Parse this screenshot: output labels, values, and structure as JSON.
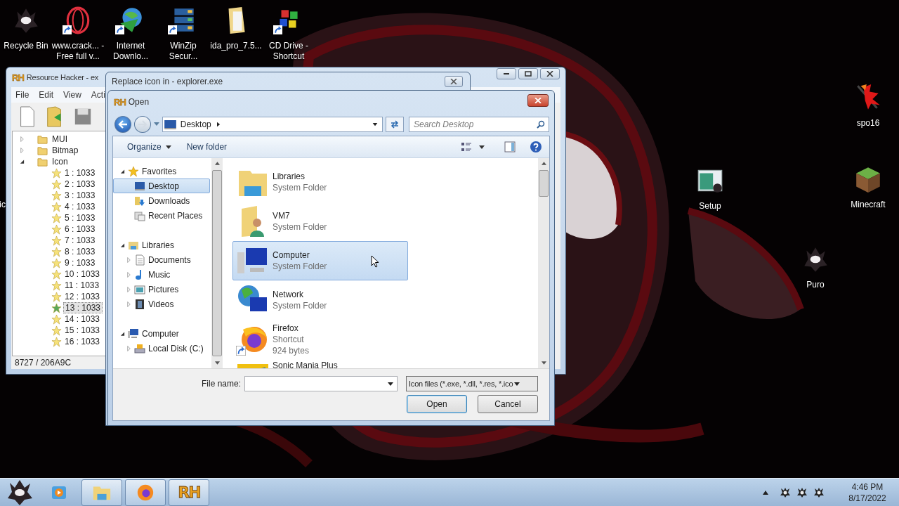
{
  "desktop_icons": [
    {
      "label": "Recycle Bin",
      "kind": "creature",
      "shortcut": false
    },
    {
      "label": "www.crack... - Free full v...",
      "kind": "ring",
      "shortcut": true
    },
    {
      "label": "Internet Downlo...",
      "kind": "globe",
      "shortcut": true
    },
    {
      "label": "WinZip Secur...",
      "kind": "server",
      "shortcut": true
    },
    {
      "label": "ida_pro_7.5...",
      "kind": "folder",
      "shortcut": false
    },
    {
      "label": "CD Drive - Shortcut",
      "kind": "tiles",
      "shortcut": true
    },
    {
      "label": "spo16",
      "kind": "splash",
      "shortcut": false
    },
    {
      "label": "Setup",
      "kind": "setup",
      "shortcut": false
    },
    {
      "label": "Minecraft",
      "kind": "block",
      "shortcut": false
    },
    {
      "label": "Puro",
      "kind": "creature",
      "shortcut": false
    },
    {
      "label": "ic",
      "kind": "partial",
      "shortcut": false
    }
  ],
  "resource_hacker": {
    "logo": "RH",
    "title": "Resource Hacker - ex",
    "menu": [
      "File",
      "Edit",
      "View",
      "Acti"
    ],
    "tree": [
      {
        "label": "MUI",
        "expanded": false
      },
      {
        "label": "Bitmap",
        "expanded": false
      },
      {
        "label": "Icon",
        "expanded": true,
        "children": [
          {
            "label": "1 : 1033",
            "selected": false
          },
          {
            "label": "2 : 1033",
            "selected": false
          },
          {
            "label": "3 : 1033",
            "selected": false
          },
          {
            "label": "4 : 1033",
            "selected": false
          },
          {
            "label": "5 : 1033",
            "selected": false
          },
          {
            "label": "6 : 1033",
            "selected": false
          },
          {
            "label": "7 : 1033",
            "selected": false
          },
          {
            "label": "8 : 1033",
            "selected": false
          },
          {
            "label": "9 : 1033",
            "selected": false
          },
          {
            "label": "10 : 1033",
            "selected": false
          },
          {
            "label": "11 : 1033",
            "selected": false
          },
          {
            "label": "12 : 1033",
            "selected": false
          },
          {
            "label": "13 : 1033",
            "selected": true
          },
          {
            "label": "14 : 1033",
            "selected": false
          },
          {
            "label": "15 : 1033",
            "selected": false
          },
          {
            "label": "16 : 1033",
            "selected": false
          }
        ]
      }
    ],
    "status": "8727 / 206A9C"
  },
  "replace_dialog": {
    "title": "Replace icon in - explorer.exe"
  },
  "open_dialog": {
    "logo": "RH",
    "title": "Open",
    "address": "Desktop",
    "search": {
      "placeholder": "Search Desktop"
    },
    "toolbar": {
      "organize": "Organize",
      "new_folder": "New folder"
    },
    "nav": [
      {
        "label": "Favorites",
        "kind": "star",
        "expanded": true,
        "children": [
          {
            "label": "Desktop",
            "kind": "desktop",
            "selected": true
          },
          {
            "label": "Downloads",
            "kind": "downloads",
            "selected": false
          },
          {
            "label": "Recent Places",
            "kind": "recent",
            "selected": false
          }
        ]
      },
      {
        "label": "Libraries",
        "kind": "libraries",
        "expanded": true,
        "children": [
          {
            "label": "Documents",
            "kind": "documents",
            "expanded": false,
            "selected": false
          },
          {
            "label": "Music",
            "kind": "music",
            "expanded": false,
            "selected": false
          },
          {
            "label": "Pictures",
            "kind": "pictures",
            "expanded": false,
            "selected": false
          },
          {
            "label": "Videos",
            "kind": "videos",
            "expanded": false,
            "selected": false
          }
        ]
      },
      {
        "label": "Computer",
        "kind": "computer",
        "expanded": true,
        "children": [
          {
            "label": "Local Disk (C:)",
            "kind": "disk",
            "expanded": false,
            "selected": false
          }
        ]
      }
    ],
    "files": [
      {
        "name": "Libraries",
        "kind": "libraries",
        "details": [
          "System Folder"
        ],
        "selected": false
      },
      {
        "name": "VM7",
        "kind": "user-folder",
        "details": [
          "System Folder"
        ],
        "selected": false
      },
      {
        "name": "Computer",
        "kind": "computer",
        "details": [
          "System Folder"
        ],
        "selected": true
      },
      {
        "name": "Network",
        "kind": "network",
        "details": [
          "System Folder"
        ],
        "selected": false
      },
      {
        "name": "Firefox",
        "kind": "firefox",
        "details": [
          "Shortcut",
          "924 bytes"
        ],
        "selected": false
      },
      {
        "name": "Sonic Mania Plus",
        "kind": "game",
        "selected": false
      }
    ],
    "file_name_label": "File name:",
    "filter": "Icon files (*.exe, *.dll, *.res, *.ico",
    "open_button": "Open",
    "cancel_button": "Cancel"
  },
  "taskbar": {
    "items": [
      {
        "kind": "media"
      },
      {
        "kind": "explorer"
      },
      {
        "kind": "firefox"
      },
      {
        "kind": "rh",
        "text": "RH"
      }
    ],
    "time": "4:46 PM",
    "date": "8/17/2022"
  }
}
